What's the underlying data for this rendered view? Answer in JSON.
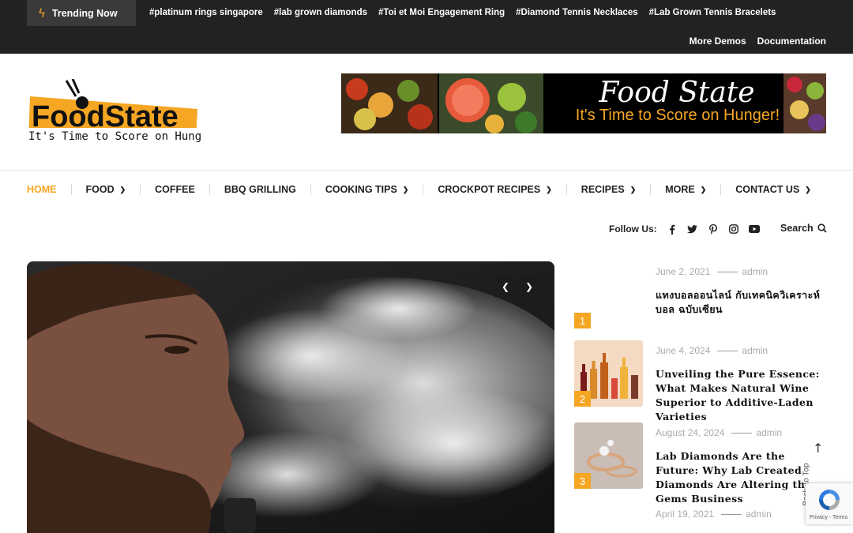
{
  "topbar": {
    "trending_label": "Trending Now",
    "tags": [
      "#platinum rings singapore",
      "#lab grown diamonds",
      "#Toi et Moi Engagement Ring",
      "#Diamond Tennis Necklaces",
      "#Lab Grown Tennis Bracelets"
    ],
    "links": [
      "More Demos",
      "Documentation"
    ]
  },
  "logo": {
    "name": "FoodState",
    "tagline": "It's Time to Score on Hunger"
  },
  "banner": {
    "title": "Food State",
    "subtitle": "It's Time to Score on Hunger!"
  },
  "nav": {
    "items": [
      {
        "label": "Home",
        "active": true,
        "dropdown": false
      },
      {
        "label": "Food",
        "active": false,
        "dropdown": true
      },
      {
        "label": "Coffee",
        "active": false,
        "dropdown": false
      },
      {
        "label": "BBQ Grilling",
        "active": false,
        "dropdown": false
      },
      {
        "label": "Cooking Tips",
        "active": false,
        "dropdown": true
      },
      {
        "label": "Crockpot Recipes",
        "active": false,
        "dropdown": true
      },
      {
        "label": "Recipes",
        "active": false,
        "dropdown": true
      },
      {
        "label": "More",
        "active": false,
        "dropdown": true
      },
      {
        "label": "Contact Us",
        "active": false,
        "dropdown": true
      }
    ]
  },
  "follow": {
    "label": "Follow Us:",
    "icons": [
      "facebook-icon",
      "twitter-icon",
      "pinterest-icon",
      "instagram-icon",
      "youtube-icon"
    ]
  },
  "search": {
    "label": "Search"
  },
  "posts": [
    {
      "num": "1",
      "date": "June 2, 2021",
      "author": "admin",
      "title": "แทงบอลออนไลน์ กับเทคนิควิเคราะห์บอล ฉบับเซียน"
    },
    {
      "num": "2",
      "date": "June 4, 2024",
      "author": "admin",
      "title": "Unveiling the Pure Essence: What Makes Natural Wine Superior to Additive-Laden Varieties"
    },
    {
      "num": "3",
      "date": "August 24, 2024",
      "author": "admin",
      "title": "Lab Diamonds Are the Future: Why Lab Created Diamonds Are Altering the Gems Business"
    },
    {
      "num": "",
      "date": "April 19, 2021",
      "author": "admin",
      "title": ""
    }
  ],
  "back_to_top": "Back To Top",
  "recaptcha": "Privacy - Terms",
  "colors": {
    "accent": "#f5a623",
    "topbar": "#222222"
  }
}
